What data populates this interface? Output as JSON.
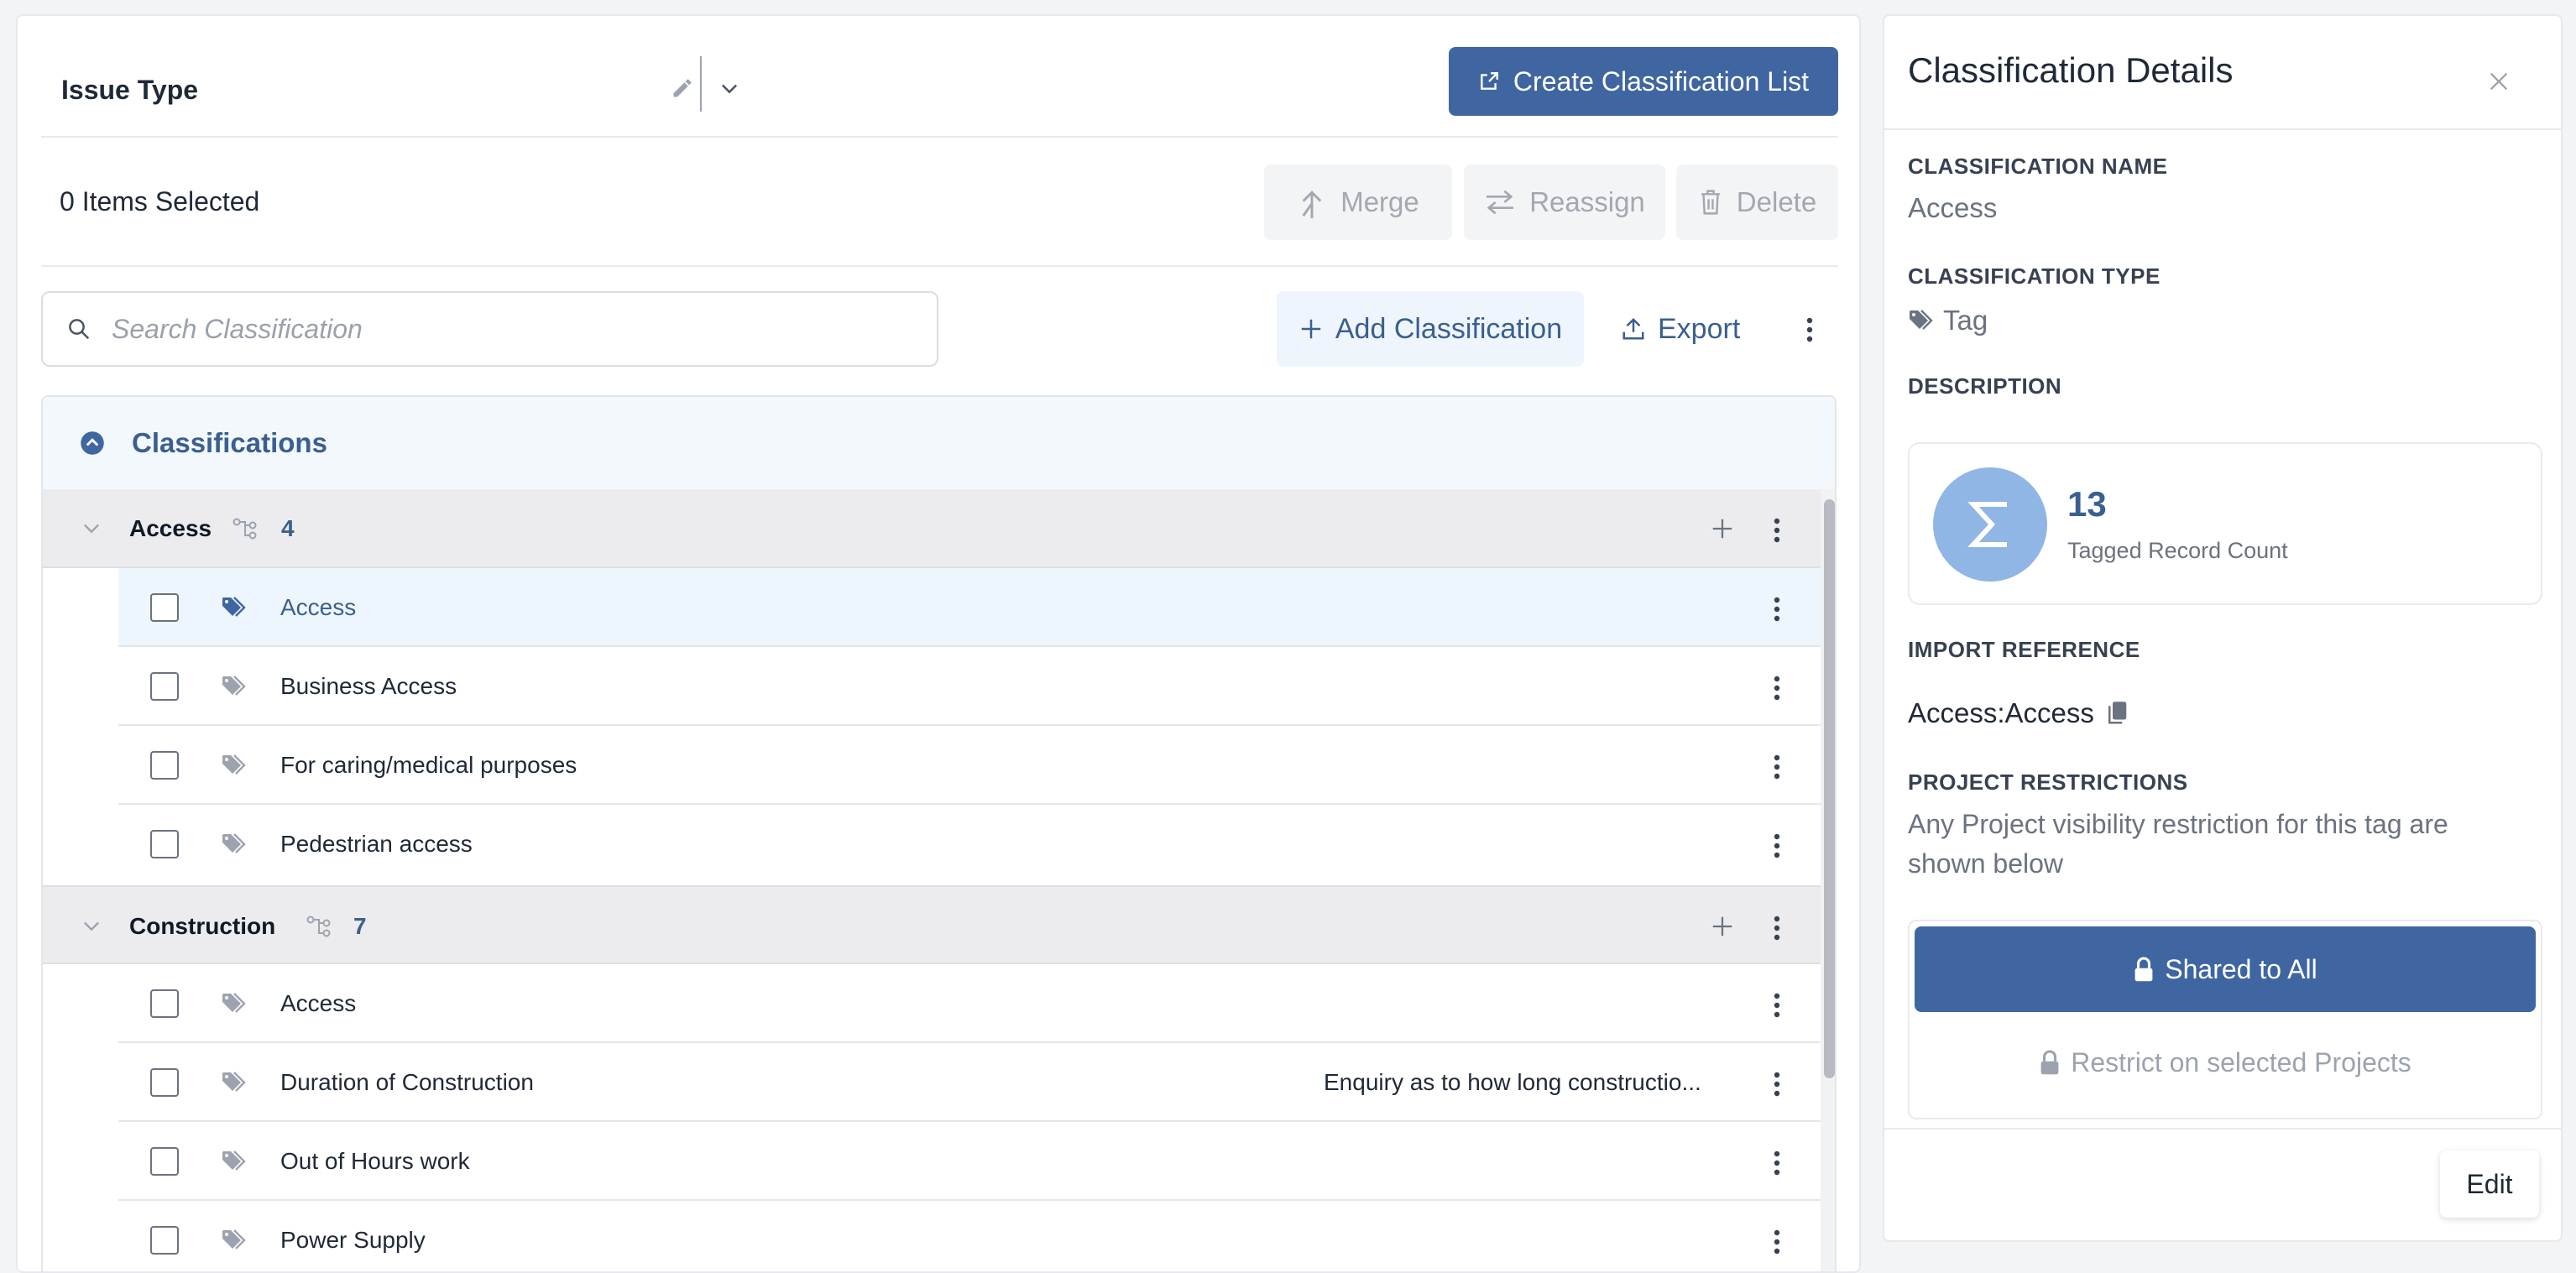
{
  "header": {
    "title": "Issue Type",
    "create_button": "Create Classification List"
  },
  "selection": {
    "count_text": "0 Items Selected",
    "merge": "Merge",
    "reassign": "Reassign",
    "delete": "Delete"
  },
  "search": {
    "placeholder": "Search Classification"
  },
  "toolbar": {
    "add_classification": "Add Classification",
    "export": "Export"
  },
  "tree": {
    "root_label": "Classifications",
    "groups": [
      {
        "name": "Access",
        "count": "4",
        "items": [
          {
            "label": "Access",
            "description": "",
            "selected": true
          },
          {
            "label": "Business Access",
            "description": ""
          },
          {
            "label": "For caring/medical purposes",
            "description": ""
          },
          {
            "label": "Pedestrian access",
            "description": ""
          }
        ]
      },
      {
        "name": "Construction",
        "count": "7",
        "items": [
          {
            "label": "Access",
            "description": ""
          },
          {
            "label": "Duration of Construction",
            "description": "Enquiry as to how long constructio..."
          },
          {
            "label": "Out of Hours work",
            "description": ""
          },
          {
            "label": "Power Supply",
            "description": ""
          }
        ]
      }
    ]
  },
  "details": {
    "title": "Classification Details",
    "name_label": "CLASSIFICATION NAME",
    "name_value": "Access",
    "type_label": "CLASSIFICATION TYPE",
    "type_value": "Tag",
    "description_label": "DESCRIPTION",
    "count_value": "13",
    "count_caption": "Tagged Record Count",
    "import_label": "IMPORT REFERENCE",
    "import_value": "Access:Access",
    "restrictions_label": "PROJECT RESTRICTIONS",
    "restrictions_text": "Any Project visibility restriction for this tag are shown below",
    "shared_button": "Shared to All",
    "restrict_button": "Restrict on selected Projects",
    "edit_button": "Edit"
  },
  "colors": {
    "primary": "#3f66a1",
    "accent_circle": "#8fb6e4",
    "link_blue": "#3b5f8f"
  }
}
